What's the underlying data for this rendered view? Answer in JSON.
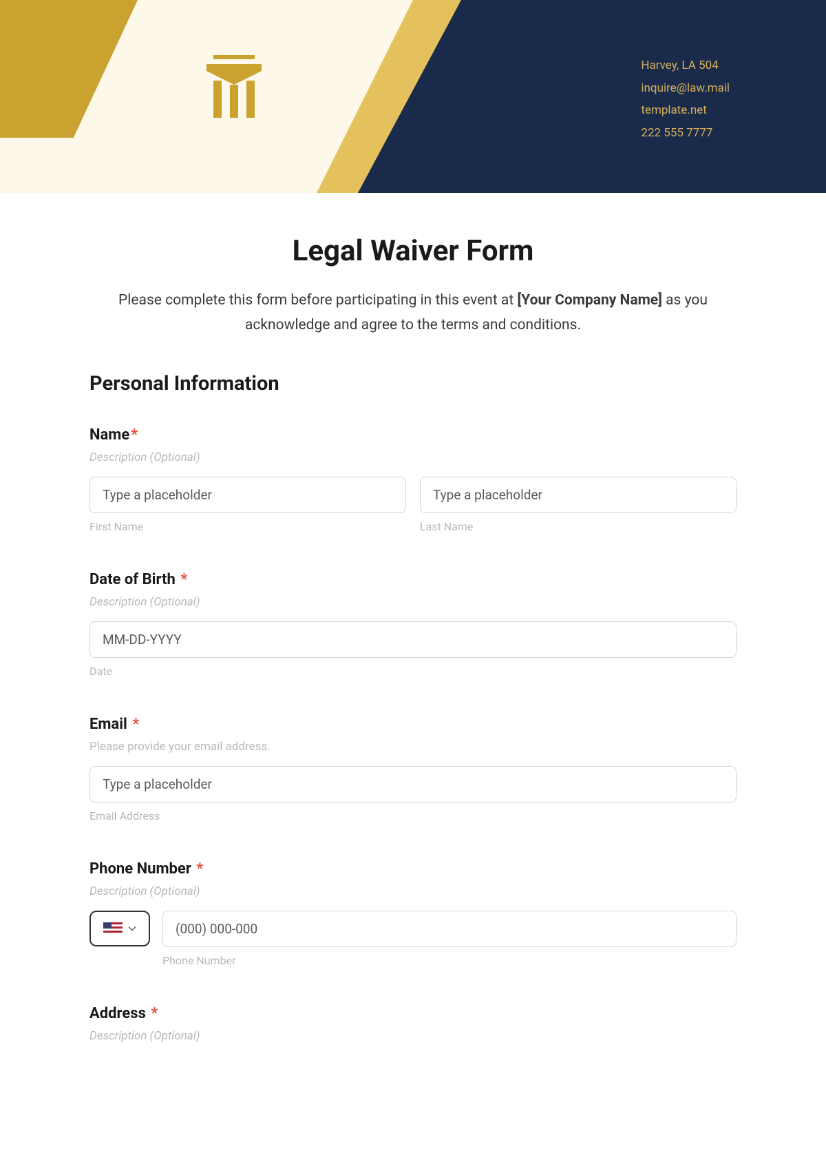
{
  "header": {
    "contact": {
      "address": "Harvey, LA 504",
      "email": "inquire@law.mail",
      "website": "template.net",
      "phone": "222 555 7777"
    }
  },
  "form": {
    "title": "Legal Waiver Form",
    "subtitle_pre": "Please complete this form before participating in this event at ",
    "subtitle_bold": "[Your Company Name]",
    "subtitle_post": " as you acknowledge and agree to the terms and conditions.",
    "section_heading": "Personal Information"
  },
  "fields": {
    "name": {
      "label": "Name",
      "description": "Description (Optional)",
      "first_placeholder": "Type a placeholder",
      "first_sublabel": "First Name",
      "last_placeholder": "Type a placeholder",
      "last_sublabel": "Last Name"
    },
    "dob": {
      "label": "Date of Birth",
      "description": "Description (Optional)",
      "placeholder": "MM-DD-YYYY",
      "sublabel": "Date"
    },
    "email": {
      "label": "Email",
      "description": "Please provide your email address.",
      "placeholder": "Type a placeholder",
      "sublabel": "Email Address"
    },
    "phone": {
      "label": "Phone Number",
      "description": "Description (Optional)",
      "placeholder": "(000) 000-000",
      "sublabel": "Phone Number"
    },
    "address": {
      "label": "Address",
      "description": "Description (Optional)"
    }
  }
}
